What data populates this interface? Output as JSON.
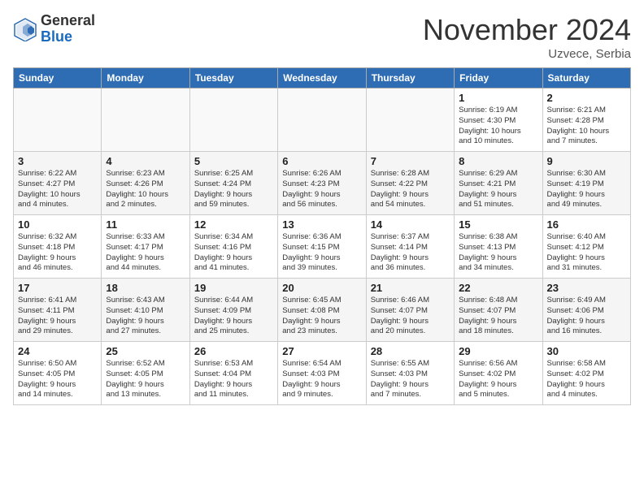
{
  "header": {
    "logo_general": "General",
    "logo_blue": "Blue",
    "month_title": "November 2024",
    "location": "Uzvece, Serbia"
  },
  "days_of_week": [
    "Sunday",
    "Monday",
    "Tuesday",
    "Wednesday",
    "Thursday",
    "Friday",
    "Saturday"
  ],
  "weeks": [
    [
      {
        "day": "",
        "info": "",
        "empty": true
      },
      {
        "day": "",
        "info": "",
        "empty": true
      },
      {
        "day": "",
        "info": "",
        "empty": true
      },
      {
        "day": "",
        "info": "",
        "empty": true
      },
      {
        "day": "",
        "info": "",
        "empty": true
      },
      {
        "day": "1",
        "info": "Sunrise: 6:19 AM\nSunset: 4:30 PM\nDaylight: 10 hours\nand 10 minutes."
      },
      {
        "day": "2",
        "info": "Sunrise: 6:21 AM\nSunset: 4:28 PM\nDaylight: 10 hours\nand 7 minutes."
      }
    ],
    [
      {
        "day": "3",
        "info": "Sunrise: 6:22 AM\nSunset: 4:27 PM\nDaylight: 10 hours\nand 4 minutes."
      },
      {
        "day": "4",
        "info": "Sunrise: 6:23 AM\nSunset: 4:26 PM\nDaylight: 10 hours\nand 2 minutes."
      },
      {
        "day": "5",
        "info": "Sunrise: 6:25 AM\nSunset: 4:24 PM\nDaylight: 9 hours\nand 59 minutes."
      },
      {
        "day": "6",
        "info": "Sunrise: 6:26 AM\nSunset: 4:23 PM\nDaylight: 9 hours\nand 56 minutes."
      },
      {
        "day": "7",
        "info": "Sunrise: 6:28 AM\nSunset: 4:22 PM\nDaylight: 9 hours\nand 54 minutes."
      },
      {
        "day": "8",
        "info": "Sunrise: 6:29 AM\nSunset: 4:21 PM\nDaylight: 9 hours\nand 51 minutes."
      },
      {
        "day": "9",
        "info": "Sunrise: 6:30 AM\nSunset: 4:19 PM\nDaylight: 9 hours\nand 49 minutes."
      }
    ],
    [
      {
        "day": "10",
        "info": "Sunrise: 6:32 AM\nSunset: 4:18 PM\nDaylight: 9 hours\nand 46 minutes."
      },
      {
        "day": "11",
        "info": "Sunrise: 6:33 AM\nSunset: 4:17 PM\nDaylight: 9 hours\nand 44 minutes."
      },
      {
        "day": "12",
        "info": "Sunrise: 6:34 AM\nSunset: 4:16 PM\nDaylight: 9 hours\nand 41 minutes."
      },
      {
        "day": "13",
        "info": "Sunrise: 6:36 AM\nSunset: 4:15 PM\nDaylight: 9 hours\nand 39 minutes."
      },
      {
        "day": "14",
        "info": "Sunrise: 6:37 AM\nSunset: 4:14 PM\nDaylight: 9 hours\nand 36 minutes."
      },
      {
        "day": "15",
        "info": "Sunrise: 6:38 AM\nSunset: 4:13 PM\nDaylight: 9 hours\nand 34 minutes."
      },
      {
        "day": "16",
        "info": "Sunrise: 6:40 AM\nSunset: 4:12 PM\nDaylight: 9 hours\nand 31 minutes."
      }
    ],
    [
      {
        "day": "17",
        "info": "Sunrise: 6:41 AM\nSunset: 4:11 PM\nDaylight: 9 hours\nand 29 minutes."
      },
      {
        "day": "18",
        "info": "Sunrise: 6:43 AM\nSunset: 4:10 PM\nDaylight: 9 hours\nand 27 minutes."
      },
      {
        "day": "19",
        "info": "Sunrise: 6:44 AM\nSunset: 4:09 PM\nDaylight: 9 hours\nand 25 minutes."
      },
      {
        "day": "20",
        "info": "Sunrise: 6:45 AM\nSunset: 4:08 PM\nDaylight: 9 hours\nand 23 minutes."
      },
      {
        "day": "21",
        "info": "Sunrise: 6:46 AM\nSunset: 4:07 PM\nDaylight: 9 hours\nand 20 minutes."
      },
      {
        "day": "22",
        "info": "Sunrise: 6:48 AM\nSunset: 4:07 PM\nDaylight: 9 hours\nand 18 minutes."
      },
      {
        "day": "23",
        "info": "Sunrise: 6:49 AM\nSunset: 4:06 PM\nDaylight: 9 hours\nand 16 minutes."
      }
    ],
    [
      {
        "day": "24",
        "info": "Sunrise: 6:50 AM\nSunset: 4:05 PM\nDaylight: 9 hours\nand 14 minutes."
      },
      {
        "day": "25",
        "info": "Sunrise: 6:52 AM\nSunset: 4:05 PM\nDaylight: 9 hours\nand 13 minutes."
      },
      {
        "day": "26",
        "info": "Sunrise: 6:53 AM\nSunset: 4:04 PM\nDaylight: 9 hours\nand 11 minutes."
      },
      {
        "day": "27",
        "info": "Sunrise: 6:54 AM\nSunset: 4:03 PM\nDaylight: 9 hours\nand 9 minutes."
      },
      {
        "day": "28",
        "info": "Sunrise: 6:55 AM\nSunset: 4:03 PM\nDaylight: 9 hours\nand 7 minutes."
      },
      {
        "day": "29",
        "info": "Sunrise: 6:56 AM\nSunset: 4:02 PM\nDaylight: 9 hours\nand 5 minutes."
      },
      {
        "day": "30",
        "info": "Sunrise: 6:58 AM\nSunset: 4:02 PM\nDaylight: 9 hours\nand 4 minutes."
      }
    ]
  ]
}
